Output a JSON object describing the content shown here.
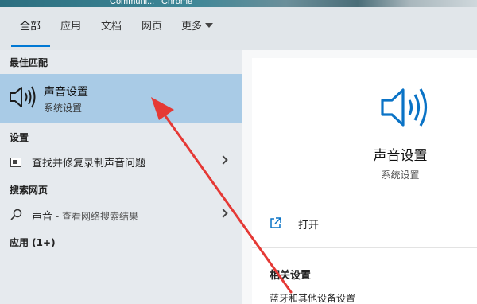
{
  "desktop": {
    "labels": [
      "Communi...",
      "Chrome"
    ]
  },
  "tabs": [
    {
      "label": "全部",
      "active": true
    },
    {
      "label": "应用",
      "active": false
    },
    {
      "label": "文档",
      "active": false
    },
    {
      "label": "网页",
      "active": false
    },
    {
      "label": "更多",
      "active": false,
      "icon": "chevron-down-icon"
    }
  ],
  "results": {
    "best_match_header": "最佳匹配",
    "best_match": {
      "title": "声音设置",
      "subtitle": "系统设置",
      "icon": "speaker-icon"
    },
    "settings_header": "设置",
    "settings_items": [
      {
        "label": "查找并修复录制声音问题",
        "icon": "troubleshoot-icon"
      }
    ],
    "web_header": "搜索网页",
    "web_items": [
      {
        "label": "声音",
        "suffix": " - 查看网络搜索结果",
        "icon": "search-icon"
      }
    ],
    "apps_header": "应用 (1+)"
  },
  "detail": {
    "title": "声音设置",
    "subtitle": "系统设置",
    "icon": "speaker-icon",
    "open_label": "打开",
    "related_header": "相关设置",
    "related_items": [
      "蓝牙和其他设备设置"
    ]
  },
  "colors": {
    "accent": "#0078d4",
    "selected_bg": "#a9cbe6",
    "annotation_arrow": "#e53935"
  }
}
